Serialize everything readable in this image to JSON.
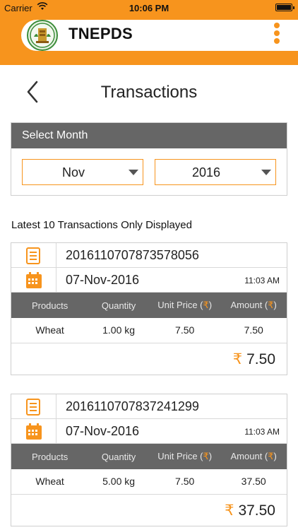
{
  "status_bar": {
    "carrier": "Carrier",
    "time": "10:06 PM"
  },
  "app": {
    "title": "TNEPDS",
    "menu_icon": "more-vertical-icon",
    "logo": "tamil-nadu-emblem"
  },
  "page": {
    "title": "Transactions",
    "back_icon": "chevron-left-icon"
  },
  "month_select": {
    "heading": "Select Month",
    "month": "Nov",
    "year": "2016"
  },
  "note": "Latest 10 Transactions Only Displayed",
  "currency_symbol": "₹",
  "colors": {
    "accent": "#f7941d",
    "header_gray": "#666666"
  },
  "table_headers": {
    "products": "Products",
    "quantity": "Quantity",
    "unit_price": "Unit Price (₹)",
    "amount": "Amount (₹)"
  },
  "transactions": [
    {
      "id": "2016110707873578056",
      "date": "07-Nov-2016",
      "time": "11:03 AM",
      "items": [
        {
          "product": "Wheat",
          "quantity": "1.00 kg",
          "unit_price": "7.50",
          "amount": "7.50"
        }
      ],
      "total": "7.50"
    },
    {
      "id": "2016110707837241299",
      "date": "07-Nov-2016",
      "time": "11:03 AM",
      "items": [
        {
          "product": "Wheat",
          "quantity": "5.00 kg",
          "unit_price": "7.50",
          "amount": "37.50"
        }
      ],
      "total": "37.50"
    }
  ]
}
